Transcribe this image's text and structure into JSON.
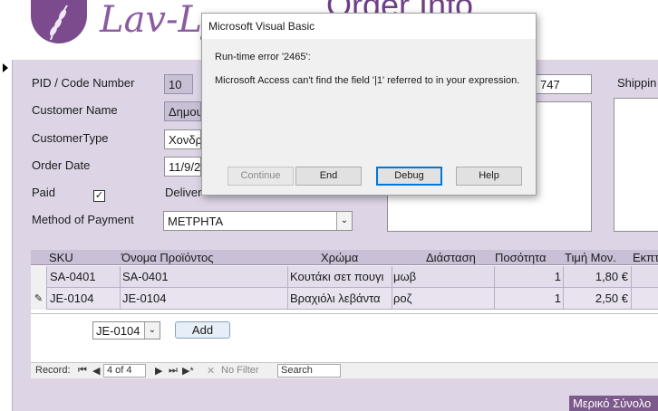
{
  "header": {
    "logo_text": "Lav-Ly",
    "form_title": "Order Info"
  },
  "form": {
    "pid_label": "PID / Code Number",
    "pid_value": "10",
    "customer_name_label": "Customer Name",
    "customer_name_value": "Δημουλ",
    "customer_type_label": "CustomerType",
    "customer_type_value": "Χονδρι",
    "order_date_label": "Order Date",
    "order_date_value": "11/9/20",
    "paid_label": "Paid",
    "paid_checked": "✓",
    "delivered_label": "Delivered",
    "payment_label": "Method of Payment",
    "payment_value": "ΜΕΤΡΗΤΑ",
    "phone_partial": "747",
    "shipping_label": "Shippin"
  },
  "grid": {
    "columns": [
      "SKU",
      "Όνομα Προϊόντος",
      "Χρώμα",
      "Διάσταση",
      "Ποσότητα",
      "Τιμή Μον.",
      "Εκπτ"
    ],
    "rows": [
      {
        "sku": "SA-0401",
        "name": "SA-0401",
        "color": "Κουτάκι σετ πουγι",
        "dimension": "μωβ",
        "qty": "1",
        "price": "1,80 €",
        "selector": ""
      },
      {
        "sku": "JE-0104",
        "name": "JE-0104",
        "color": "Βραχιόλι λεβάντα",
        "dimension": "ροζ",
        "qty": "1",
        "price": "2,50 €",
        "selector": "✎"
      }
    ],
    "new_row_selector": "…"
  },
  "subform_footer": {
    "product_combo_value": "JE-0104",
    "add_button": "Add"
  },
  "navigation": {
    "record_label": "Record:",
    "first": "⏮",
    "prev": "◀",
    "position": "4 of 4",
    "next": "▶",
    "last": "⏭",
    "new": "▶*",
    "no_filter": "No Filter",
    "search_placeholder": "Search"
  },
  "subtotal_label": "Μερικό Σύνολο",
  "dialog": {
    "title": "Microsoft Visual Basic",
    "error_line": "Run-time error '2465':",
    "message": "Microsoft Access can't find the field '|1' referred to in your expression.",
    "buttons": {
      "continue": "Continue",
      "end": "End",
      "debug": "Debug",
      "help": "Help"
    }
  },
  "colors": {
    "brand_purple": "#7b4b8e",
    "panel_lavender": "#ddd5e6",
    "focus_blue": "#0078d7"
  }
}
